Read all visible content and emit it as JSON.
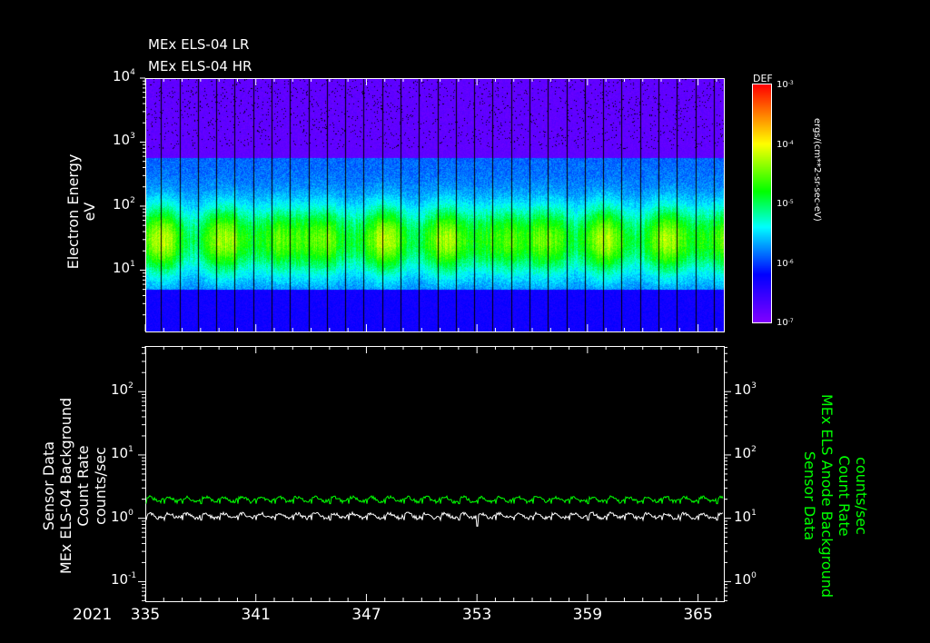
{
  "chart_data": [
    {
      "type": "heatmap",
      "titles": [
        "MEx ELS-04 LR",
        "MEx ELS-04 HR"
      ],
      "ylabel": "Electron Energy",
      "yunits": "eV",
      "yscale": "log",
      "ylim": [
        1.1,
        10000
      ],
      "yticks": [
        {
          "base": "10",
          "exp": "4",
          "v": 10000
        },
        {
          "base": "10",
          "exp": "3",
          "v": 1000
        },
        {
          "base": "10",
          "exp": "2",
          "v": 100
        },
        {
          "base": "10",
          "exp": "1",
          "v": 10
        }
      ],
      "xlim": [
        335,
        366.4
      ],
      "colorbar": {
        "label": "DEF",
        "units": "ergs/(cm**2-sr-sec-eV)",
        "range": [
          1e-07,
          0.001
        ],
        "ticks": [
          {
            "base": "10",
            "exp": "-3"
          },
          {
            "base": "10",
            "exp": "-4"
          },
          {
            "base": "10",
            "exp": "-5"
          },
          {
            "base": "10",
            "exp": "-6"
          },
          {
            "base": "10",
            "exp": "-7"
          }
        ]
      },
      "peak_energy_ev": 30,
      "band_ev": [
        5,
        400
      ]
    },
    {
      "type": "line",
      "ylabel_left": [
        "Sensor Data",
        "MEx ELS-04 Background",
        "Count Rate",
        "counts/sec"
      ],
      "ylabel_right": [
        "Sensor Data",
        "MEx ELS Anode Background",
        "Count Rate",
        "counts/sec"
      ],
      "yscale": "log",
      "ylim_left": [
        0.049,
        525
      ],
      "ylim_right": [
        0.49,
        5250
      ],
      "yticks_left": [
        {
          "base": "10",
          "exp": "2"
        },
        {
          "base": "10",
          "exp": "1"
        },
        {
          "base": "10",
          "exp": "0"
        },
        {
          "base": "10",
          "exp": "-1"
        }
      ],
      "yticks_right": [
        {
          "base": "10",
          "exp": "3"
        },
        {
          "base": "10",
          "exp": "2"
        },
        {
          "base": "10",
          "exp": "1"
        },
        {
          "base": "10",
          "exp": "0"
        }
      ],
      "xlabel_year": "2021",
      "xticks": [
        "335",
        "341",
        "347",
        "353",
        "359",
        "365"
      ],
      "xlim": [
        335,
        366.4
      ],
      "series": [
        {
          "name": "MEx ELS-04 Background",
          "axis": "left",
          "color": "#ffffff",
          "mean": 1.1,
          "min": 0.75
        },
        {
          "name": "MEx ELS Anode Background",
          "axis": "right",
          "color": "#00ff00",
          "mean": 20,
          "min": 15
        }
      ]
    }
  ]
}
